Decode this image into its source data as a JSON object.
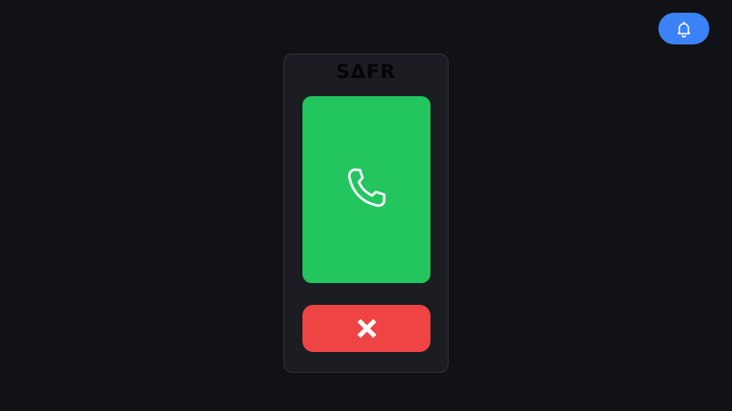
{
  "brand": {
    "logo_text": "SΔFR"
  },
  "header": {
    "notification_icon": "bell-icon"
  },
  "call": {
    "answer_icon": "phone-icon",
    "decline_icon": "close-icon"
  },
  "colors": {
    "background": "#111215",
    "panel": "#1b1d22",
    "notify_accent": "#3b82f6",
    "answer": "#22c55e",
    "decline": "#ef4444"
  }
}
